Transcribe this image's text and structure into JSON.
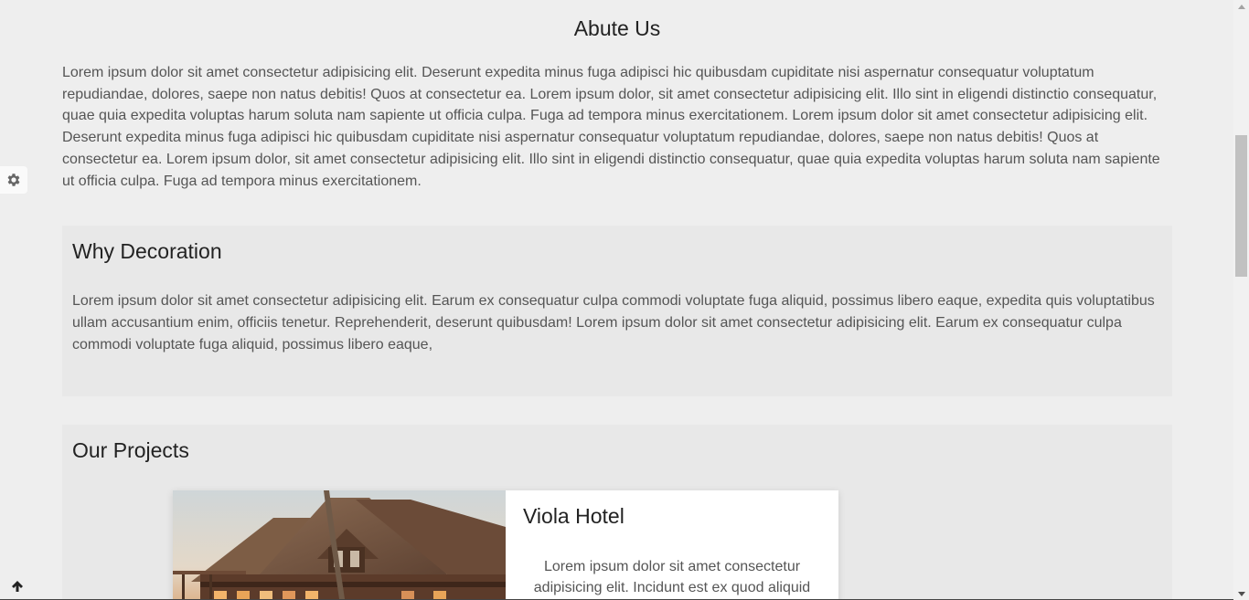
{
  "about": {
    "title": "Abute Us",
    "text": "Lorem ipsum dolor sit amet consectetur adipisicing elit. Deserunt expedita minus fuga adipisci hic quibusdam cupiditate nisi aspernatur consequatur voluptatum repudiandae, dolores, saepe non natus debitis! Quos at consectetur ea. Lorem ipsum dolor, sit amet consectetur adipisicing elit. Illo sint in eligendi distinctio consequatur, quae quia expedita voluptas harum soluta nam sapiente ut officia culpa. Fuga ad tempora minus exercitationem. Lorem ipsum dolor sit amet consectetur adipisicing elit. Deserunt expedita minus fuga adipisci hic quibusdam cupiditate nisi aspernatur consequatur voluptatum repudiandae, dolores, saepe non natus debitis! Quos at consectetur ea. Lorem ipsum dolor, sit amet consectetur adipisicing elit. Illo sint in eligendi distinctio consequatur, quae quia expedita voluptas harum soluta nam sapiente ut officia culpa. Fuga ad tempora minus exercitationem."
  },
  "why": {
    "title": "Why Decoration",
    "text": "Lorem ipsum dolor sit amet consectetur adipisicing elit. Earum ex consequatur culpa commodi voluptate fuga aliquid, possimus libero eaque, expedita quis voluptatibus ullam accusantium enim, officiis tenetur. Reprehenderit, deserunt quibusdam! Lorem ipsum dolor sit amet consectetur adipisicing elit. Earum ex consequatur culpa commodi voluptate fuga aliquid, possimus libero eaque,"
  },
  "projects": {
    "title": "Our Projects",
    "items": [
      {
        "title": "Viola Hotel",
        "text": "Lorem ipsum dolor sit amet consectetur adipisicing elit. Incidunt est ex quod aliquid"
      }
    ]
  },
  "icons": {
    "settings": "gear-icon",
    "back_to_top": "arrow-up-icon"
  },
  "colors": {
    "page_background": "#eeeeee",
    "panel_background": "#e8e8e8",
    "heading": "#222222",
    "body_text": "#555555"
  }
}
